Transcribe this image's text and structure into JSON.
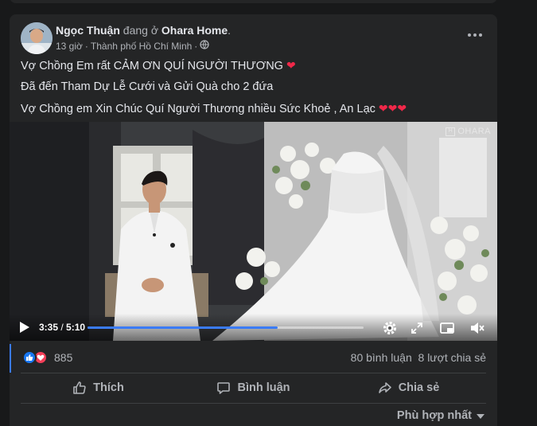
{
  "post": {
    "author": "Ngọc Thuận",
    "checkin_prefix": "đang ở",
    "location_page": "Ohara Home",
    "location_suffix": ".",
    "time": "13 giờ",
    "separator": "·",
    "place": "Thành phố Hồ Chí Minh",
    "separator2": "·",
    "privacy_icon": "globe-icon",
    "lines": [
      "Vợ Chồng Em rất CẢM ƠN QUÍ NGƯỜI THƯƠNG",
      "Đã đến Tham Dự Lễ Cưới và Gửi Quà cho 2 đứa",
      "Vợ Chồng em Xin Chúc Quí Người Thương nhiều Sức Khoẻ , An Lạc"
    ],
    "line1_emoji": "❤",
    "line3_emoji": "❤❤❤"
  },
  "video": {
    "watermark": "OHARA",
    "watermark_mark": "H",
    "current_time": "3:35",
    "time_sep": " / ",
    "duration": "5:10",
    "progress": 0.69
  },
  "stats": {
    "reactions": "885",
    "comments": "80 bình luận",
    "shares": "8 lượt chia sẻ"
  },
  "actions": {
    "like": "Thích",
    "comment": "Bình luận",
    "share": "Chia sẻ"
  },
  "sort": {
    "label": "Phù hợp nhất"
  },
  "colors": {
    "background": "#18191a",
    "card": "#242526",
    "accent": "#1877f2",
    "heart": "#f02849",
    "text_secondary": "#b0b3b8"
  }
}
